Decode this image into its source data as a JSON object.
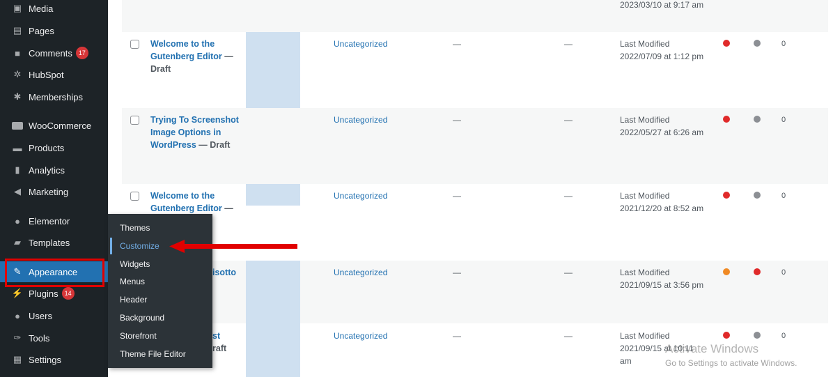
{
  "sidebar": {
    "items": [
      {
        "label": "Media",
        "icon": "media-icon"
      },
      {
        "label": "Pages",
        "icon": "pages-icon"
      },
      {
        "label": "Comments",
        "icon": "comments-icon",
        "badge": "17"
      },
      {
        "label": "HubSpot",
        "icon": "hubspot-icon"
      },
      {
        "label": "Memberships",
        "icon": "memberships-icon"
      },
      {
        "label": "WooCommerce",
        "icon": "woocommerce-icon"
      },
      {
        "label": "Products",
        "icon": "products-icon"
      },
      {
        "label": "Analytics",
        "icon": "analytics-icon"
      },
      {
        "label": "Marketing",
        "icon": "marketing-icon"
      },
      {
        "label": "Elementor",
        "icon": "elementor-icon"
      },
      {
        "label": "Templates",
        "icon": "templates-icon"
      },
      {
        "label": "Appearance",
        "icon": "appearance-icon"
      },
      {
        "label": "Plugins",
        "icon": "plugins-icon",
        "badge": "14"
      },
      {
        "label": "Users",
        "icon": "users-icon"
      },
      {
        "label": "Tools",
        "icon": "tools-icon"
      },
      {
        "label": "Settings",
        "icon": "settings-icon"
      }
    ]
  },
  "appearance_submenu": {
    "items": [
      "Themes",
      "Customize",
      "Widgets",
      "Menus",
      "Header",
      "Background",
      "Storefront",
      "Theme File Editor"
    ],
    "current": "Customize"
  },
  "posts": {
    "top_partial_date": "2023/03/10 at 9:17 am",
    "rows": [
      {
        "title": "Welcome to the Gutenberg Editor",
        "title_lines": [
          "Welcome to the",
          "Gutenberg Editor"
        ],
        "state": "Draft",
        "category": "Uncategorized",
        "col_a": "—",
        "col_b": "—",
        "date_label": "Last Modified",
        "date": "2022/07/09 at 1:12 pm",
        "count": "0"
      },
      {
        "title": "Trying To Screenshot Image Options in WordPress",
        "title_lines": [
          "Trying To Screenshot",
          "Image Options in",
          "WordPress"
        ],
        "state": "Draft",
        "category": "Uncategorized",
        "col_a": "—",
        "col_b": "—",
        "date_label": "Last Modified",
        "date": "2022/05/27 at 6:26 am",
        "count": "0"
      },
      {
        "title": "Welcome to the Gutenberg Editor",
        "title_lines": [
          "Welcome to the",
          "Gutenberg Editor"
        ],
        "state": "",
        "category": "Uncategorized",
        "col_a": "—",
        "col_b": "—",
        "date_label": "Last Modified",
        "date": "2021/12/20 at 8:52 am",
        "count": "0"
      },
      {
        "title": "isotto",
        "title_lines": [
          "isotto"
        ],
        "state": "",
        "category": "Uncategorized",
        "col_a": "—",
        "col_b": "—",
        "date_label": "Last Modified",
        "date": "2021/09/15 at 3:56 pm",
        "count": "0"
      },
      {
        "title": "st",
        "title_lines": [
          "st"
        ],
        "state": "raft",
        "category": "Uncategorized",
        "col_a": "—",
        "col_b": "—",
        "date_label": "Last Modified",
        "date_lines": [
          "2021/09/15 at 10:11",
          "am"
        ],
        "count": "0"
      }
    ]
  },
  "colors": {
    "red": "#e02a2a",
    "gray": "#8c8f94",
    "orange": "#f08a24"
  },
  "watermark": {
    "line1": "Activate Windows",
    "line2": "Go to Settings to activate Windows."
  }
}
